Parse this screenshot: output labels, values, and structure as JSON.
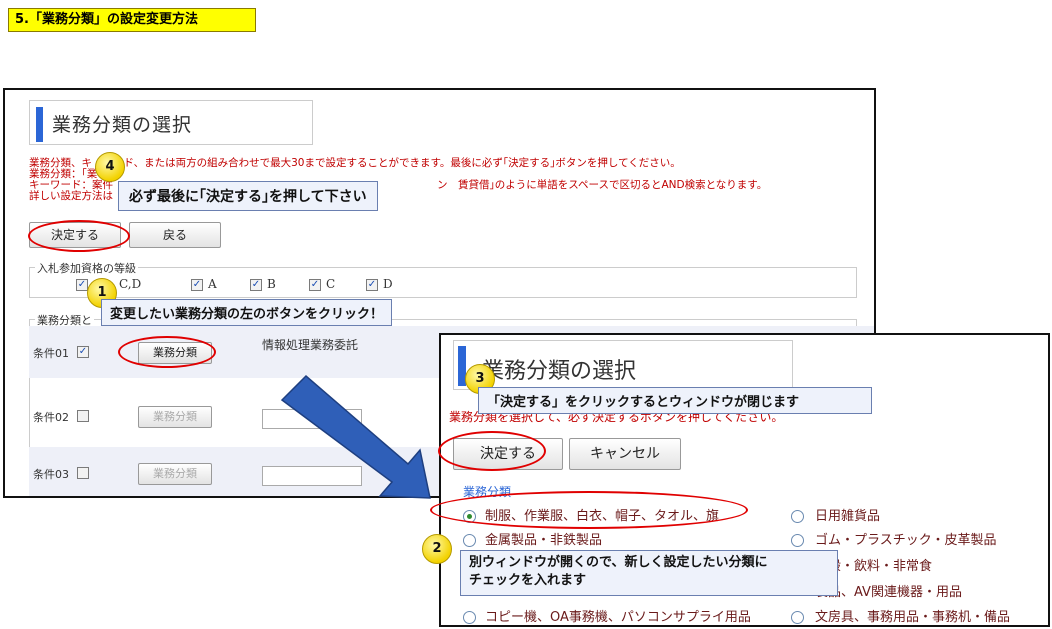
{
  "section_title": "5.「業務分類」の設定変更方法",
  "main_window": {
    "title": "業務分類の選択",
    "notice_lines": [
      "業務分類、キ　　　ド、または両方の組み合わせで最大30まで設定することができます。最後に必ず｢決定する｣ボタンを押してください。",
      "業務分類：｢業",
      "キーワード：案件",
      "詳しい設定方法は"
    ],
    "notice_tail": "ン　賃貸借｣のように単語をスペースで区切るとAND検索となります。",
    "decide_button": "決定する",
    "back_button": "戻る",
    "grade_legend": "入札参加資格の等級",
    "grades": [
      {
        "label": "C,D",
        "checked": true
      },
      {
        "label": "A",
        "checked": true
      },
      {
        "label": "B",
        "checked": true
      },
      {
        "label": "C",
        "checked": true
      },
      {
        "label": "D",
        "checked": true
      }
    ],
    "conditions_legend": "業務分類と",
    "category_button": "業務分類",
    "rows": [
      {
        "label": "条件01",
        "checked": true,
        "value": "情報処理業務委託"
      },
      {
        "label": "条件02",
        "checked": false,
        "value": ""
      },
      {
        "label": "条件03",
        "checked": false,
        "value": ""
      }
    ]
  },
  "popup_window": {
    "title": "業務分類の選択",
    "notice": "業務分類を選択して、必ず決定するボタンを押してください。",
    "decide_button": "決定する",
    "cancel_button": "キャンセル",
    "legend": "業務分類",
    "options": [
      {
        "label": "制服、作業服、白衣、帽子、タオル、旗",
        "selected": true
      },
      {
        "label": "日用雑貨品",
        "selected": false
      },
      {
        "label": "金属製品・非鉄製品",
        "selected": false
      },
      {
        "label": "ゴム・プラスチック・皮革製品",
        "selected": false
      },
      {
        "label": "全般・飲料・非常食",
        "selected": false
      },
      {
        "label": "製品、AV関連機器・用品",
        "selected": false
      },
      {
        "label": "コピー機、OA事務機、パソコンサプライ用品",
        "selected": false
      },
      {
        "label": "文房具、事務用品・事務机・備品",
        "selected": false
      }
    ]
  },
  "callouts": {
    "step1": {
      "number": "1",
      "text": "変更したい業務分類の左のボタンをクリック！"
    },
    "step2": {
      "number": "2",
      "text_line1": "別ウィンドウが開くので、新しく設定したい分類に",
      "text_line2": "チェックを入れます"
    },
    "step3": {
      "number": "3",
      "text": "「決定する」をクリックするとウィンドウが閉じます"
    },
    "step4": {
      "number": "4",
      "text": "必ず最後に｢決定する｣を押して下さい"
    }
  },
  "colors": {
    "highlight": "#ffff00",
    "accent": "#2b66d6",
    "annotation_red": "#e00000",
    "arrow": "#2f5fb8"
  }
}
